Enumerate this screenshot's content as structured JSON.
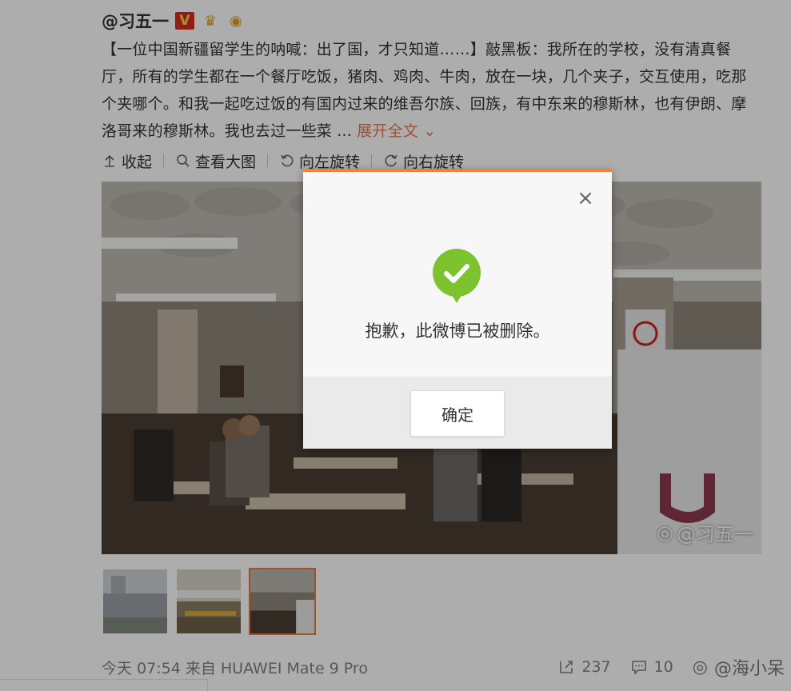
{
  "post": {
    "username": "@习五一",
    "badge_v": "V",
    "content": "【一位中国新疆留学生的呐喊：出了国，才只知道……】敲黑板：我所在的学校，没有清真餐厅，所有的学生都在一个餐厅吃饭，猪肉、鸡肉、牛肉，放在一块，几个夹子，交互使用，吃那个夹哪个。和我一起吃过饭的有国内过来的维吾尔族、回族，有中东来的穆斯林，也有伊朗、摩洛哥来的穆斯林。我也去过一些菜 ...",
    "expand_label": "展开全文",
    "toolbar": {
      "collapse": "收起",
      "view_large": "查看大图",
      "rotate_left": "向左旋转",
      "rotate_right": "向右旋转"
    },
    "image_watermark": "@习五一",
    "footer": {
      "time_source": "今天 07:54 来自 HUAWEI Mate 9 Pro",
      "repost_count": "237",
      "comment_count": "10"
    },
    "watermark": "@海小呆"
  },
  "dialog": {
    "message": "抱歉，此微博已被删除。",
    "confirm_label": "确定"
  },
  "colors": {
    "accent": "#fa7d3c",
    "success": "#7dc22f",
    "expand": "#eb7350"
  }
}
